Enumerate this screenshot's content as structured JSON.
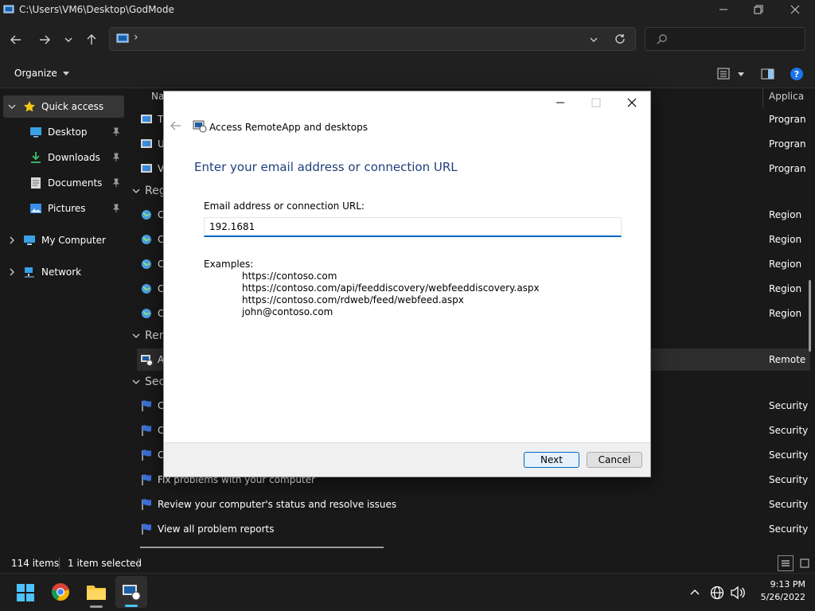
{
  "window": {
    "title": "C:\\Users\\VM6\\Desktop\\GodMode"
  },
  "nav": {
    "address_sep": "›",
    "search_placeholder": ""
  },
  "toolbar": {
    "organize_label": "Organize"
  },
  "sidebar": {
    "items": [
      {
        "label": "Quick access"
      },
      {
        "label": "Desktop"
      },
      {
        "label": "Downloads"
      },
      {
        "label": "Documents"
      },
      {
        "label": "Pictures"
      },
      {
        "label": "My Computer"
      },
      {
        "label": "Network"
      }
    ]
  },
  "content": {
    "header_name": "Na",
    "header_category": "Applica",
    "top_rows": [
      {
        "name": "T",
        "category": "Progran"
      },
      {
        "name": "U",
        "category": "Progran"
      },
      {
        "name": "V",
        "category": "Progran"
      }
    ],
    "group_region": "Reg",
    "region_rows": [
      {
        "name": "C",
        "category": "Region"
      },
      {
        "name": "C",
        "category": "Region"
      },
      {
        "name": "C",
        "category": "Region"
      },
      {
        "name": "C",
        "category": "Region"
      },
      {
        "name": "C",
        "category": "Region"
      }
    ],
    "group_remote": "Rem",
    "remote_rows": [
      {
        "name": "A",
        "category": "Remote"
      }
    ],
    "group_security": "Sec",
    "security_rows": [
      {
        "name": "C",
        "category": "Security"
      },
      {
        "name": "C",
        "category": "Security"
      },
      {
        "name": "C",
        "category": "Security"
      },
      {
        "name": "Fix problems with your computer",
        "category": "Security"
      },
      {
        "name": "Review your computer's status and resolve issues",
        "category": "Security"
      },
      {
        "name": "View all problem reports",
        "category": "Security"
      }
    ]
  },
  "status": {
    "items_count": "114 items",
    "selected": "1 item selected"
  },
  "taskbar": {
    "time": "9:13 PM",
    "date": "5/26/2022"
  },
  "dialog": {
    "title": "Access RemoteApp and desktops",
    "heading": "Enter your email address or connection URL",
    "field_label": "Email address or connection URL:",
    "field_value": "192.1681",
    "examples_label": "Examples:",
    "examples": [
      "https://contoso.com",
      "https://contoso.com/api/feeddiscovery/webfeeddiscovery.aspx",
      "https://contoso.com/rdweb/feed/webfeed.aspx",
      "john@contoso.com"
    ],
    "next_label": "Next",
    "cancel_label": "Cancel"
  },
  "colors": {
    "accent": "#0067c0",
    "heading": "#1f3f7a",
    "dark_bg": "#191919"
  }
}
